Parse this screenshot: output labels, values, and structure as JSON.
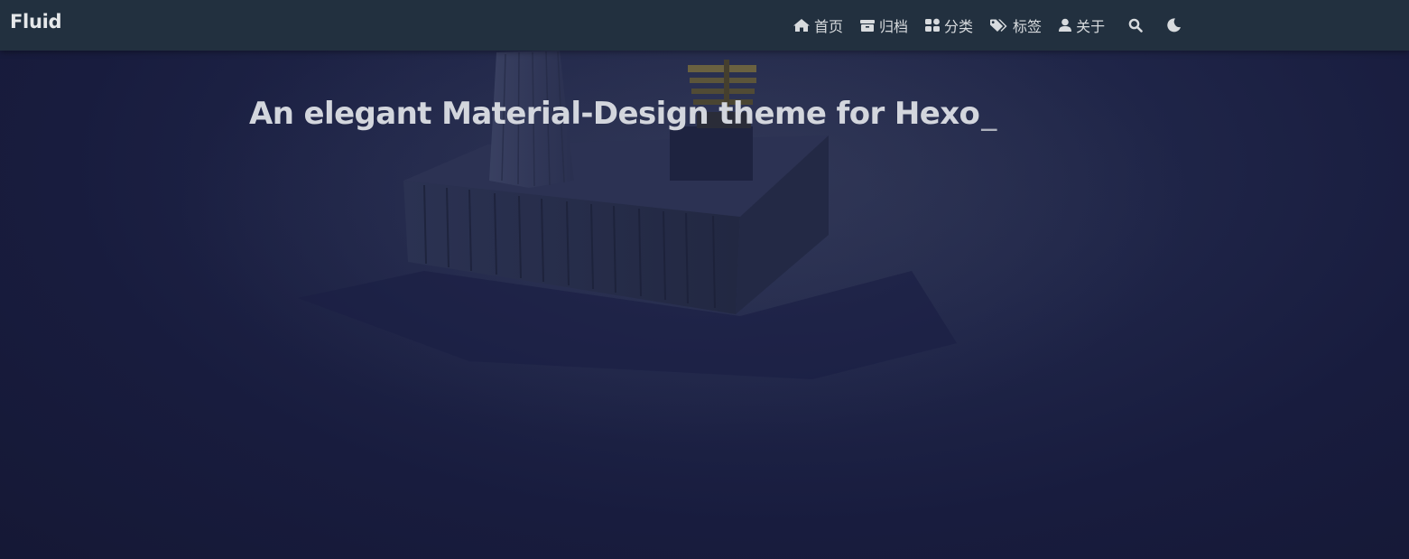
{
  "brand": {
    "name": "Fluid"
  },
  "nav": {
    "items": [
      {
        "label": "首页",
        "icon": "home-icon"
      },
      {
        "label": "归档",
        "icon": "archive-icon"
      },
      {
        "label": "分类",
        "icon": "category-icon"
      },
      {
        "label": "标签",
        "icon": "tags-icon"
      },
      {
        "label": "关于",
        "icon": "user-icon"
      }
    ],
    "search_icon": "search-icon",
    "theme_icon": "moon-icon"
  },
  "banner": {
    "subtitle": "An elegant Material-Design theme for Hexo",
    "typing_cursor": "_"
  },
  "colors": {
    "navbar_bg": "#22303f",
    "banner_bg": "#181c3e",
    "text": "#d8dbde"
  }
}
